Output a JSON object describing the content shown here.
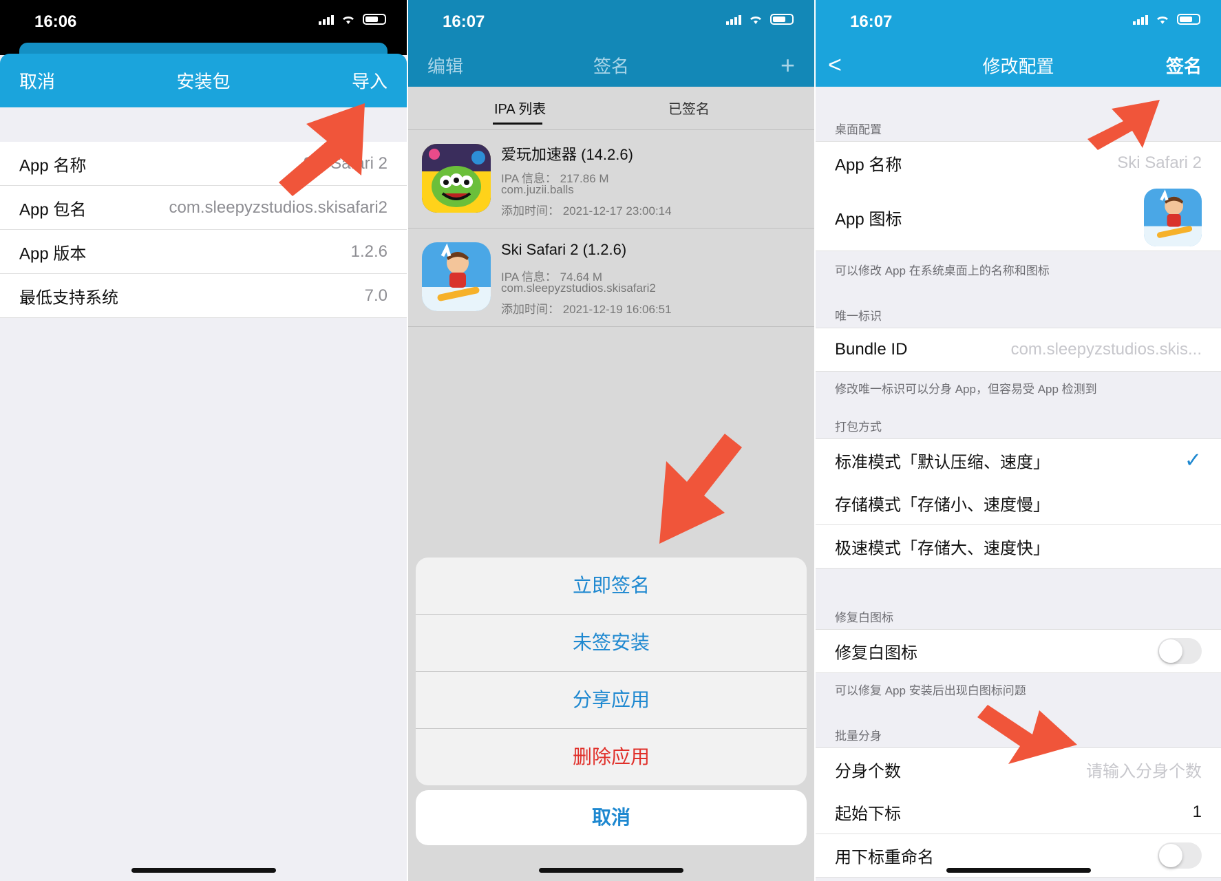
{
  "panel1": {
    "status": {
      "time": "16:06"
    },
    "nav": {
      "left": "取消",
      "title": "安装包",
      "right": "导入"
    },
    "rows": [
      {
        "label": "App 名称",
        "value": "Ski Safari 2"
      },
      {
        "label": "App 包名",
        "value": "com.sleepyzstudios.skisafari2"
      },
      {
        "label": "App 版本",
        "value": "1.2.6"
      },
      {
        "label": "最低支持系统",
        "value": "7.0"
      }
    ]
  },
  "panel2": {
    "status": {
      "time": "16:07"
    },
    "nav": {
      "left": "编辑",
      "title": "签名",
      "right": "+"
    },
    "tabs": [
      "IPA 列表",
      "已签名"
    ],
    "items": [
      {
        "title": "爱玩加速器 (14.2.6)",
        "info": "IPA 信息：  217.86 M",
        "bundle": "com.juzii.balls",
        "added": "添加时间：  2021-12-17 23:00:14"
      },
      {
        "title": "Ski Safari 2 (1.2.6)",
        "info": "IPA 信息：  74.64 M",
        "bundle": "com.sleepyzstudios.skisafari2",
        "added": "添加时间：  2021-12-19 16:06:51"
      }
    ],
    "sheet": [
      "立即签名",
      "未签安装",
      "分享应用",
      "删除应用"
    ],
    "cancel": "取消"
  },
  "panel3": {
    "status": {
      "time": "16:07"
    },
    "nav": {
      "left": "<",
      "title": "修改配置",
      "right": "签名"
    },
    "section_desktop": "桌面配置",
    "app_name_label": "App 名称",
    "app_name_value": "Ski Safari 2",
    "app_icon_label": "App 图标",
    "desktop_note": "可以修改 App 在系统桌面上的名称和图标",
    "section_unique": "唯一标识",
    "bundle_label": "Bundle ID",
    "bundle_value": "com.sleepyzstudios.skis...",
    "unique_note": "修改唯一标识可以分身 App，但容易受 App 检测到",
    "section_pack": "打包方式",
    "pack_modes": [
      "标准模式「默认压缩、速度」",
      "存储模式「存储小、速度慢」",
      "极速模式「存储大、速度快」"
    ],
    "selected_mode": "标准模式「默认压缩、速度」",
    "checkmark": "✓",
    "section_fix": "修复白图标",
    "fix_label": "修复白图标",
    "fix_on": false,
    "fix_note": "可以修复 App 安装后出现白图标问题",
    "section_batch": "批量分身",
    "clone_count_label": "分身个数",
    "clone_count_placeholder": "请输入分身个数",
    "start_index_label": "起始下标",
    "start_index_value": "1",
    "rename_label": "用下标重命名",
    "rename_on": false
  },
  "colors": {
    "nav": "#1ba4dc",
    "arrow": "#f0553a",
    "link": "#1e88d0",
    "danger": "#e0302a"
  }
}
